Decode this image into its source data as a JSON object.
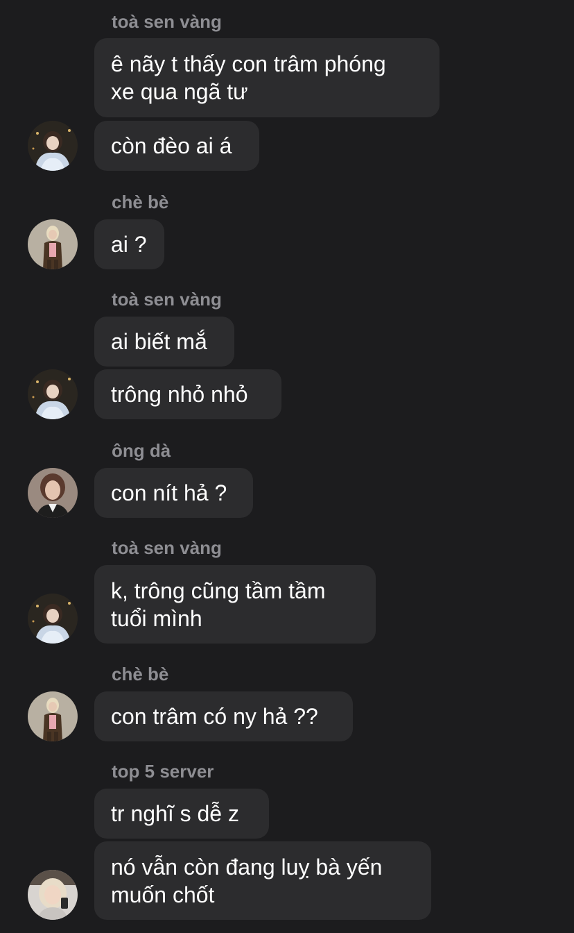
{
  "messages": [
    {
      "sender": "toà sen vàng"
    },
    {
      "text": "ê nãy t thấy con trâm phóng\nxe qua ngã tư"
    },
    {
      "text": "còn đèo ai á"
    },
    {
      "sender": "chè bè"
    },
    {
      "text": "ai ?"
    },
    {
      "sender": "toà sen vàng"
    },
    {
      "text": "ai biết mắ"
    },
    {
      "text": "trông nhỏ nhỏ"
    },
    {
      "sender": "ông dà"
    },
    {
      "text": "con nít hả ?"
    },
    {
      "sender": "toà sen vàng"
    },
    {
      "text": "k, trông cũng tầm tầm\ntuổi mình"
    },
    {
      "sender": "chè bè"
    },
    {
      "text": "con trâm có ny hả ??"
    },
    {
      "sender": "top 5 server"
    },
    {
      "text": "tr nghĩ s dễ z"
    },
    {
      "text": "nó vẫn còn đang luỵ bà yến\nmuốn chốt"
    }
  ],
  "avatars": [
    {
      "user": "toà sen vàng",
      "icon": "avatar-toa-sen-vang"
    },
    {
      "user": "chè bè",
      "icon": "avatar-che-be"
    },
    {
      "user": "toà sen vàng",
      "icon": "avatar-toa-sen-vang"
    },
    {
      "user": "ông dà",
      "icon": "avatar-ong-da"
    },
    {
      "user": "toà sen vàng",
      "icon": "avatar-toa-sen-vang"
    },
    {
      "user": "chè bè",
      "icon": "avatar-che-be"
    },
    {
      "user": "top 5 server",
      "icon": "avatar-top-5-server"
    }
  ],
  "colors": {
    "background": "#1c1c1e",
    "bubble": "#2c2c2e",
    "sender_name": "#8e8e93",
    "message_text": "#ffffff"
  }
}
